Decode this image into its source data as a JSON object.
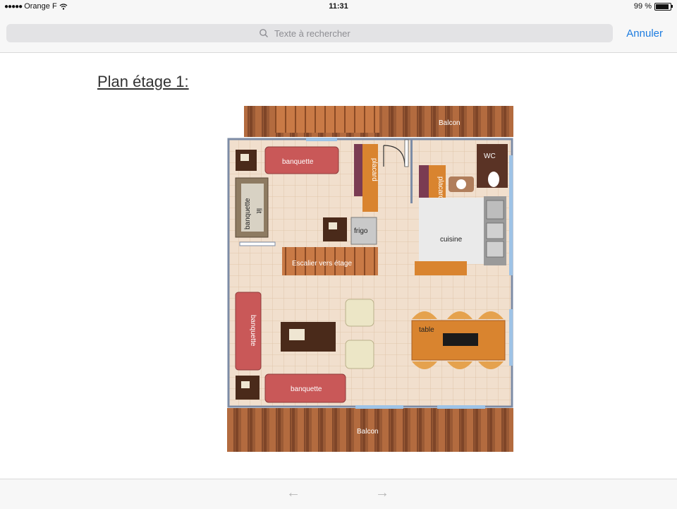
{
  "status": {
    "carrier": "Orange F",
    "time": "11:31",
    "battery": "99 %"
  },
  "search": {
    "placeholder": "Texte à rechercher",
    "cancel_label": "Annuler"
  },
  "document": {
    "title": "Plan étage 1:",
    "labels": {
      "balcon_top": "Balcon",
      "balcon_bottom": "Balcon",
      "banquette_top": "banquette",
      "banquette_left": "banquette",
      "banquette_bottom": "banquette",
      "lit": "lit",
      "banquette_lit": "banquette",
      "placard_1": "placard",
      "placard_2": "placard",
      "wc": "WC",
      "frigo": "frigo",
      "cuisine": "cuisine",
      "escalier": "Escalier vers étage",
      "table": "table"
    }
  },
  "nav": {
    "prev_icon": "←",
    "next_icon": "→"
  },
  "colors": {
    "accent": "#1d7ce0",
    "wall": "#7d8ca6",
    "floor": "#f1dfcd",
    "wood": "#9a5a35",
    "sofa": "#c95858"
  }
}
